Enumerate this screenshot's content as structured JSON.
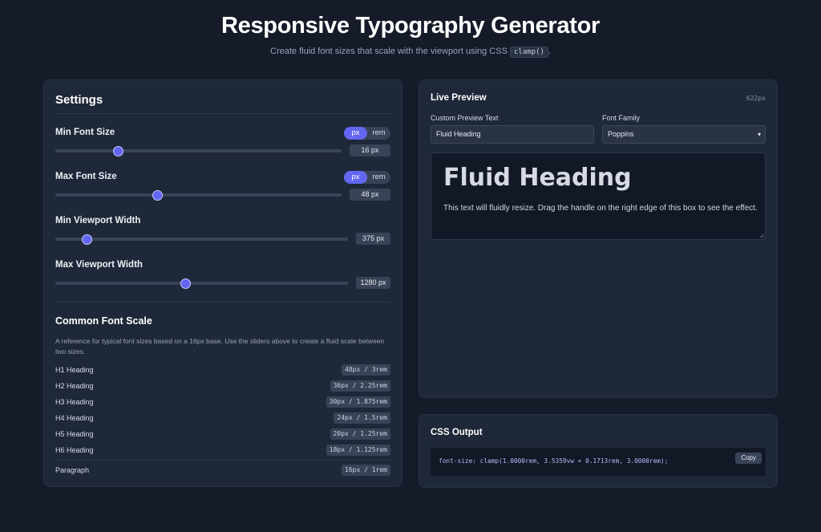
{
  "header": {
    "title": "Responsive Typography Generator",
    "subtitle_prefix": "Create fluid font sizes that scale with the viewport using CSS",
    "subtitle_code": "clamp()",
    "subtitle_suffix": "."
  },
  "settings": {
    "title": "Settings",
    "controls": [
      {
        "label": "Min Font Size",
        "value_text": "16 px",
        "fraction": 0.22,
        "units": [
          "px",
          "rem"
        ],
        "active_unit": "px"
      },
      {
        "label": "Max Font Size",
        "value_text": "48 px",
        "fraction": 0.357,
        "units": [
          "px",
          "rem"
        ],
        "active_unit": "px"
      },
      {
        "label": "Min Viewport Width",
        "value_text": "375 px",
        "fraction": 0.109
      },
      {
        "label": "Max Viewport Width",
        "value_text": "1280 px",
        "fraction": 0.446
      }
    ],
    "scale": {
      "title": "Common Font Scale",
      "description": "A reference for typical font sizes based on a 16px base. Use the sliders above to create a fluid scale between two sizes.",
      "rows": [
        {
          "name": "H1 Heading",
          "value": "48px / 3rem"
        },
        {
          "name": "H2 Heading",
          "value": "36px / 2.25rem"
        },
        {
          "name": "H3 Heading",
          "value": "30px / 1.875rem"
        },
        {
          "name": "H4 Heading",
          "value": "24px / 1.5rem"
        },
        {
          "name": "H5 Heading",
          "value": "20px / 1.25rem"
        },
        {
          "name": "H6 Heading",
          "value": "18px / 1.125rem"
        },
        {
          "name": "Paragraph",
          "value": "16px / 1rem"
        }
      ]
    }
  },
  "preview": {
    "title": "Live Preview",
    "width_readout": "622px",
    "text_label": "Custom Preview Text",
    "text_value": "Fluid Heading",
    "font_label": "Font Family",
    "font_value": "Poppins",
    "heading": "Fluid Heading",
    "body": "This text will fluidly resize. Drag the handle on the right edge of this box to see the effect."
  },
  "output": {
    "title": "CSS Output",
    "code": "font-size: clamp(1.0000rem, 3.5359vw + 0.1713rem, 3.0000rem);",
    "copy_label": "Copy"
  },
  "colors": {
    "background": "#151b29",
    "panel": "#1f2838",
    "accent": "#6366f1"
  },
  "icons": {
    "select_chevron": "chevron-down-icon",
    "resize_grip": "resize-grip-icon"
  }
}
